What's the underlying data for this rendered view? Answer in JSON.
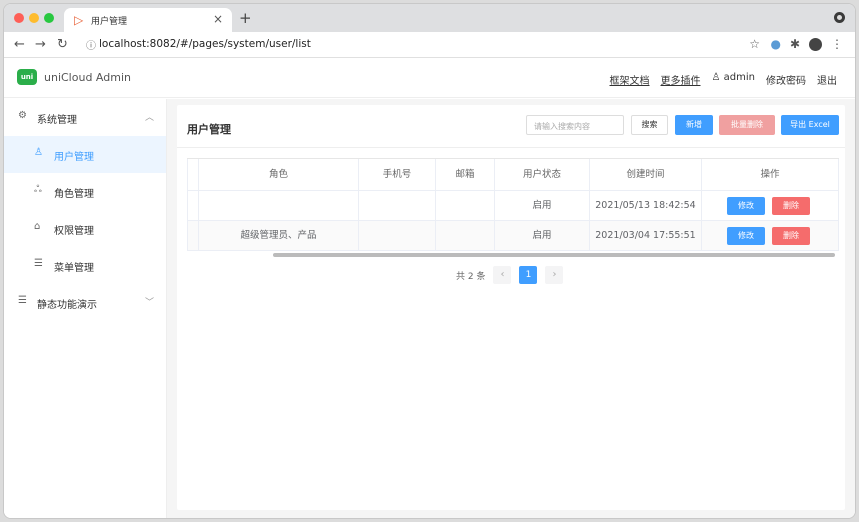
{
  "browser": {
    "tab_title": "用户管理",
    "url": "localhost:8082/#/pages/system/user/list"
  },
  "app": {
    "logo_text": "uni",
    "brand": "uniCloud Admin",
    "links": [
      "框架文档",
      "更多插件"
    ],
    "user": "admin",
    "change_password": "修改密码",
    "logout": "退出"
  },
  "sidebar": {
    "items": [
      {
        "label": "系统管理",
        "icon": "gear-icon"
      },
      {
        "label": "用户管理",
        "icon": "user-icon"
      },
      {
        "label": "角色管理",
        "icon": "role-icon"
      },
      {
        "label": "权限管理",
        "icon": "lock-icon"
      },
      {
        "label": "菜单管理",
        "icon": "menu-icon"
      },
      {
        "label": "静态功能演示",
        "icon": "list-icon"
      }
    ]
  },
  "main": {
    "title": "用户管理",
    "search_placeholder": "请输入搜索内容",
    "search_label": "搜索",
    "add_label": "新增",
    "batch_delete_label": "批量删除",
    "export_label": "导出 Excel"
  },
  "table": {
    "columns": [
      "角色",
      "手机号",
      "邮箱",
      "用户状态",
      "创建时间",
      "操作"
    ],
    "rows": [
      {
        "role": "",
        "phone": "",
        "email": "",
        "status": "启用",
        "created": "2021/05/13 18:42:54"
      },
      {
        "role": "超级管理员、产品",
        "phone": "",
        "email": "",
        "status": "启用",
        "created": "2021/03/04 17:55:51"
      }
    ],
    "edit_label": "修改",
    "delete_label": "删除"
  },
  "pagination": {
    "total_text": "共 2 条",
    "current_page": "1"
  }
}
